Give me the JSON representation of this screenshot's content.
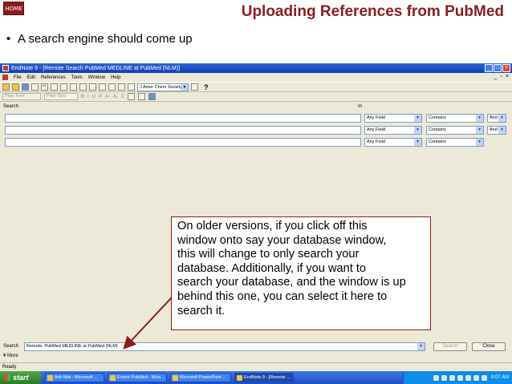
{
  "slide": {
    "home_label": "HOME",
    "title": "Uploading References from PubMed",
    "bullet": "A search engine should come up",
    "callout": "On older versions, if you click off this\nwindow onto say your database window,\nthis will change to only search your\ndatabase.  Additionally, if you want to\nsearch your database, and the window is up\nbehind this one, you can select it here to\nsearch it."
  },
  "window": {
    "title": "EndNote 9 - [Remote Search PubMed MEDLINE at PubMed (NLM)]",
    "menus": [
      "File",
      "Edit",
      "References",
      "Tools",
      "Window",
      "Help"
    ],
    "output_style": "J Amer Chem Society",
    "help_label": "?",
    "font_box": "Plain Font",
    "size_box": "Plain Size",
    "format_buttons": [
      "B",
      "I",
      "U",
      "P",
      "A¹",
      "A₁",
      "Σ"
    ],
    "search_label": "Search",
    "in_label": "In",
    "rows": [
      {
        "term": "",
        "field": "Any Field",
        "op": "Contains",
        "bool": "And"
      },
      {
        "term": "",
        "field": "Any Field",
        "op": "Contains",
        "bool": "And"
      },
      {
        "term": "",
        "field": "Any Field",
        "op": "Contains",
        "bool": ""
      }
    ],
    "bottom_search_label": "Search",
    "source": "Remote: PubMed MEDLINE at PubMed (NLM)",
    "search_button": "Search",
    "close_button": "Close",
    "more_label": "More",
    "status": "Ready"
  },
  "taskbar": {
    "start": "start",
    "tasks": [
      "Adv Mat - Microsoft ...",
      "Entrez PubMed - Mozi...",
      "Microsoft PowerPoint ...",
      "EndNote 9 - [Remote ..."
    ],
    "clock": "9:07 AM"
  },
  "colors": {
    "accent": "#8c1c1c",
    "xp_blue": "#1f4fc4"
  }
}
